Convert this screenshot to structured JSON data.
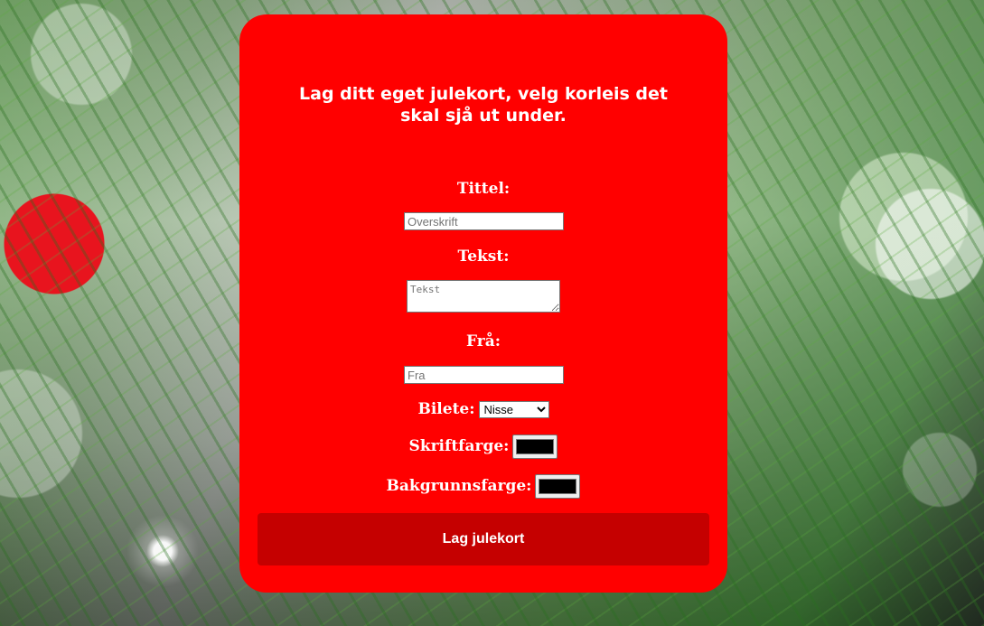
{
  "form": {
    "heading": "Lag ditt eget julekort, velg korleis det skal sjå ut under.",
    "title_label": "Tittel:",
    "title_placeholder": "Overskrift",
    "text_label": "Tekst:",
    "text_placeholder": "Tekst",
    "from_label": "Frå:",
    "from_placeholder": "Fra",
    "image_label": "Bilete:",
    "image_selected": "Nisse",
    "font_color_label": "Skriftfarge:",
    "font_color_value": "#000000",
    "bg_color_label": "Bakgrunnsfarge:",
    "bg_color_value": "#000000",
    "submit_label": "Lag julekort"
  },
  "colors": {
    "card": "#ff0000",
    "button": "#c50000",
    "text": "#ffffff"
  }
}
